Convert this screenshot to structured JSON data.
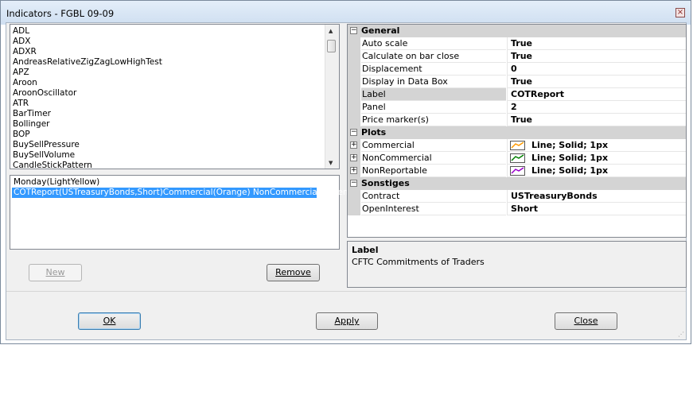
{
  "window": {
    "title": "Indicators - FGBL 09-09",
    "close_symbol": "×"
  },
  "indicator_list": {
    "items": [
      "ADL",
      "ADX",
      "ADXR",
      "AndreasRelativeZigZagLowHighTest",
      "APZ",
      "Aroon",
      "AroonOscillator",
      "ATR",
      "BarTimer",
      "Bollinger",
      "BOP",
      "BuySellPressure",
      "BuySellVolume",
      "CandleStickPattern"
    ]
  },
  "applied_list": {
    "items": [
      {
        "label": "Monday(LightYellow)",
        "selected": false
      },
      {
        "label": "COTReport(USTreasuryBonds,Short)Commercial(Orange) NonCommercial(Green)",
        "selected": true
      }
    ]
  },
  "buttons": {
    "new": "New",
    "remove": "Remove",
    "ok": "OK",
    "apply": "Apply",
    "close": "Close"
  },
  "properties": {
    "general": {
      "title": "General",
      "rows": [
        {
          "name": "Auto scale",
          "value": "True"
        },
        {
          "name": "Calculate on bar close",
          "value": "True"
        },
        {
          "name": "Displacement",
          "value": "0"
        },
        {
          "name": "Display in Data Box",
          "value": "True"
        },
        {
          "name": "Label",
          "value": "COTReport"
        },
        {
          "name": "Panel",
          "value": "2"
        },
        {
          "name": "Price marker(s)",
          "value": "True"
        }
      ]
    },
    "plots": {
      "title": "Plots",
      "rows": [
        {
          "name": "Commercial",
          "value": "Line; Solid; 1px",
          "color": "#ff9900"
        },
        {
          "name": "NonCommercial",
          "value": "Line; Solid; 1px",
          "color": "#008000"
        },
        {
          "name": "NonReportable",
          "value": "Line; Solid; 1px",
          "color": "#9900cc"
        }
      ]
    },
    "sonstiges": {
      "title": "Sonstiges",
      "rows": [
        {
          "name": "Contract",
          "value": "USTreasuryBonds"
        },
        {
          "name": "OpenInterest",
          "value": "Short"
        }
      ]
    }
  },
  "description": {
    "title": "Label",
    "text": "CFTC Commitments of Traders"
  }
}
